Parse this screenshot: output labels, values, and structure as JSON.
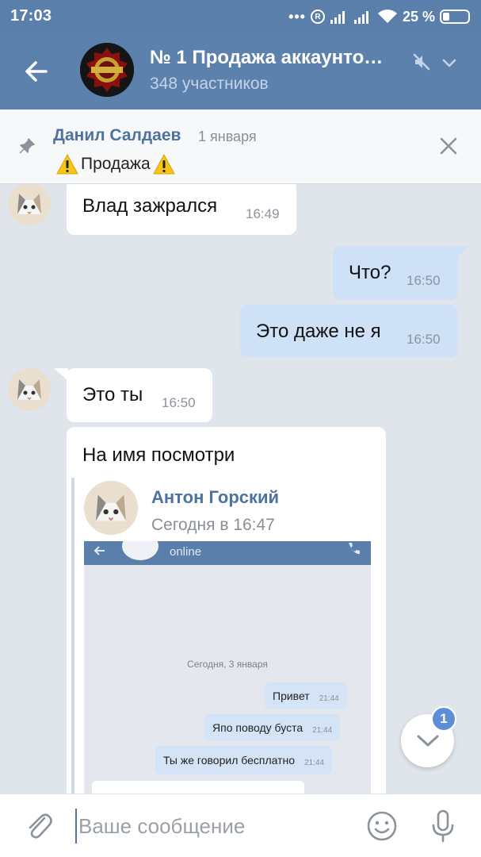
{
  "status_bar": {
    "time": "17:03",
    "battery_percent": "25 %",
    "icons": [
      "dots",
      "registered-icon",
      "signal-icon",
      "signal-icon",
      "wifi-icon",
      "battery-icon"
    ]
  },
  "header": {
    "title": "№ 1 Продажа аккаунто…",
    "subtitle": "348 участников",
    "icons": [
      "back-arrow-icon",
      "mute-icon",
      "chevron-down-icon"
    ],
    "colors": {
      "bar": "#5d81ad",
      "subtitle": "#c4d3e6"
    }
  },
  "pinned": {
    "author": "Данил Салдаев",
    "date": "1 января",
    "text": "Продажа",
    "icons": [
      "pin-icon",
      "warning-icon",
      "close-icon"
    ]
  },
  "messages": [
    {
      "dir": "in",
      "text": "Влад зажрался",
      "time": "16:49"
    },
    {
      "dir": "out",
      "text": "Что?",
      "time": "16:50"
    },
    {
      "dir": "out",
      "text": "Это даже не я",
      "time": "16:50"
    },
    {
      "dir": "in",
      "text": "Это ты",
      "time": "16:50"
    },
    {
      "dir": "in",
      "text": "На имя посмотри"
    }
  ],
  "forwarded": {
    "author": "Антон Горский",
    "date": "Сегодня в 16:47",
    "screenshot": {
      "status": "online",
      "date_separator": "Сегодня, 3 января",
      "bubbles": [
        {
          "text": "Привет",
          "time": "21:44"
        },
        {
          "text": "Япо поводу буста",
          "time": "21:44"
        },
        {
          "text": "Ты же говорил бесплатно",
          "time": "21:44"
        }
      ]
    }
  },
  "scroll_button": {
    "badge": "1"
  },
  "composer": {
    "placeholder": "Ваше сообщение",
    "value": "",
    "icons": [
      "attach-icon",
      "emoji-icon",
      "microphone-icon"
    ]
  },
  "colors": {
    "accent": "#4d72a0",
    "outgoing": "#cfe1f7",
    "incoming": "#ffffff",
    "background": "#dfe5eb"
  }
}
